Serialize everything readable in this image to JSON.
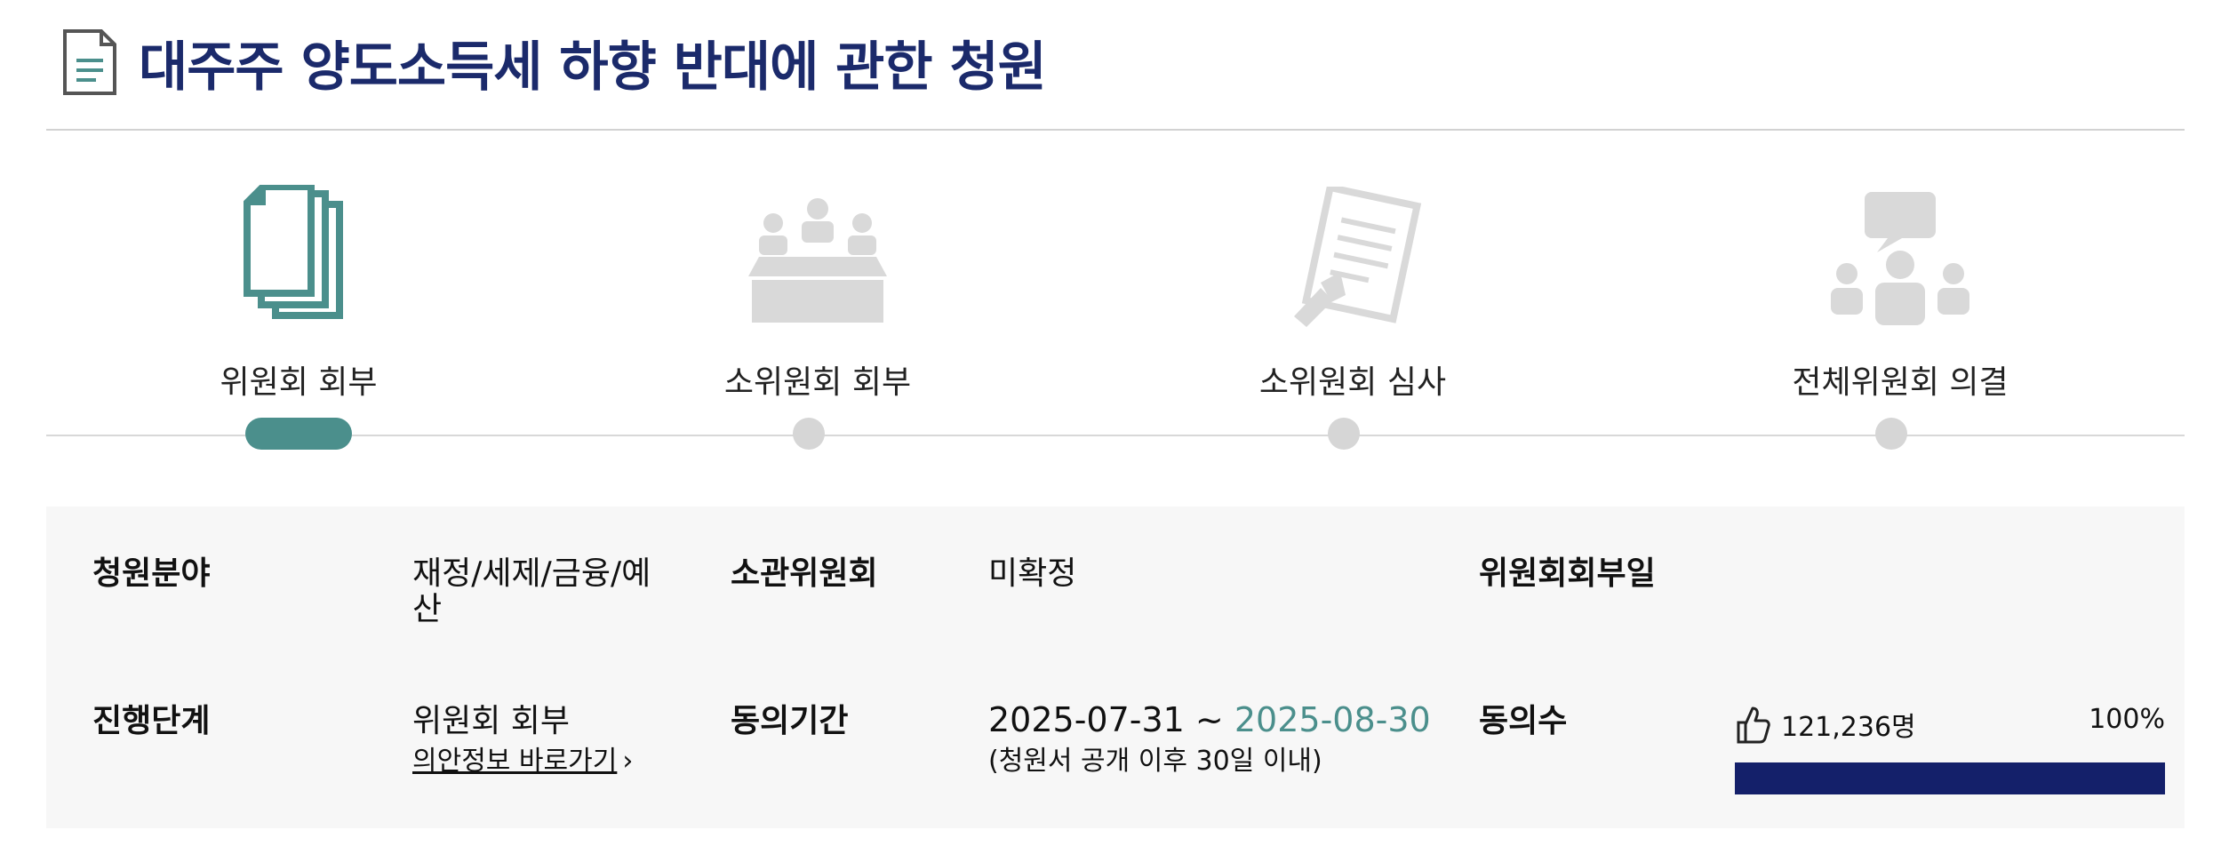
{
  "page": {
    "title": "대주주 양도소득세 하향 반대에 관한 청원",
    "title_icon": "document-icon"
  },
  "steps": [
    {
      "label": "위원회 회부",
      "icon": "documents-stack-icon",
      "active": true
    },
    {
      "label": "소위원회 회부",
      "icon": "meeting-icon",
      "active": false
    },
    {
      "label": "소위원회 심사",
      "icon": "review-document-icon",
      "active": false
    },
    {
      "label": "전체위원회 의결",
      "icon": "discussion-icon",
      "active": false
    }
  ],
  "info": {
    "field_label": "청원분야",
    "field_value": "재정/세제/금융/예산",
    "committee_label": "소관위원회",
    "committee_value": "미확정",
    "referral_date_label": "위원회회부일",
    "referral_date_value": "",
    "stage_label": "진행단계",
    "stage_value": "위원회 회부",
    "bill_link": "의안정보 바로가기",
    "period_label": "동의기간",
    "period_start": "2025-07-31 ~",
    "period_end": "2025-08-30",
    "period_note": "(청원서 공개 이후 30일 이내)",
    "agree_label": "동의수",
    "agree_count": "121,236명",
    "agree_percent": "100%",
    "agree_fraction": 1.0
  },
  "colors": {
    "title": "#1b2a6b",
    "accent_teal": "#4b8f8c",
    "progress_fill": "#14206a",
    "inactive_gray": "#d6d6d6",
    "panel_bg": "#f7f7f7"
  }
}
